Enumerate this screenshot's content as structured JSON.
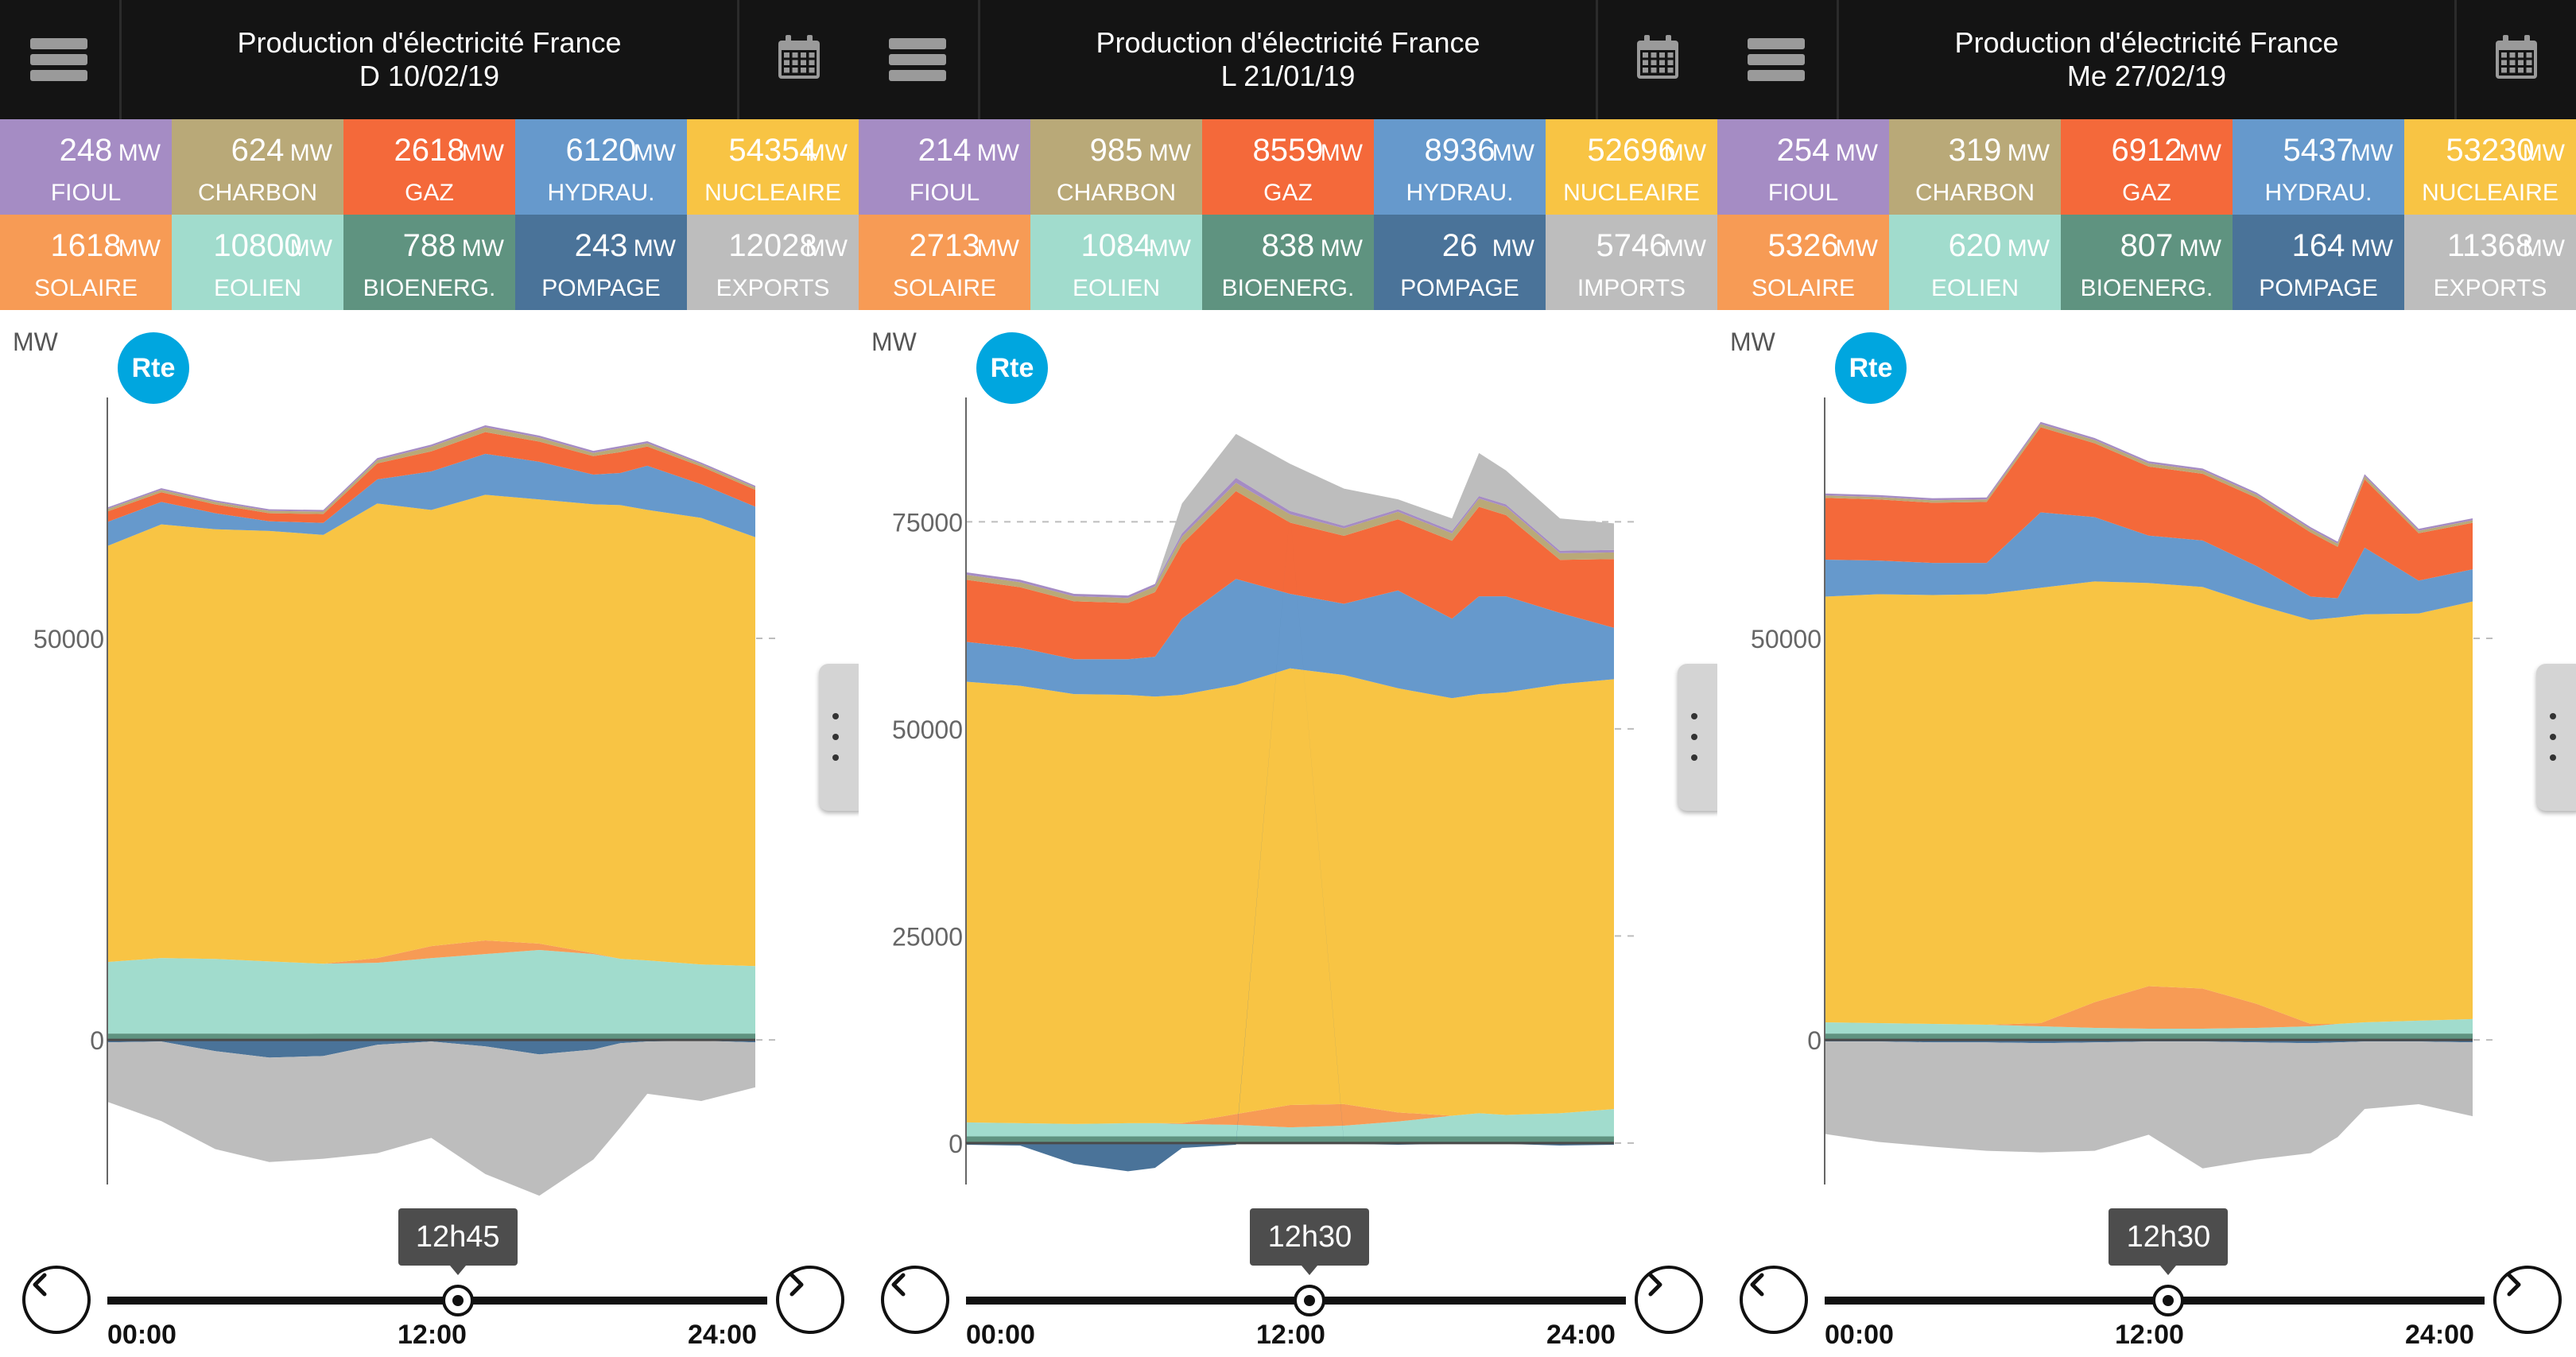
{
  "colors": {
    "fioul": "#a58cc4",
    "charbon": "#b9a978",
    "gaz": "#f4693a",
    "hydrau": "#6699cc",
    "nucleaire": "#f8c444",
    "solaire": "#f79b55",
    "eolien": "#a1dccd",
    "bioenerg": "#5f9380",
    "pompage": "#4a7399",
    "exports": "#bdbdbd",
    "rte_logo": "#00a6df",
    "header_bg": "#141414"
  },
  "icons": {
    "menu": "hamburger-menu-icon",
    "calendar": "calendar-icon",
    "more": "vertical-dots-icon",
    "prev": "chevron-left-icon",
    "next": "chevron-right-icon",
    "logo": "rte-logo"
  },
  "common": {
    "app_title": "Production d'électricité France",
    "unit": "MW",
    "y_axis_unit": "MW",
    "logo_text": "Rte",
    "time_start": "00:00",
    "time_mid": "12:00",
    "time_end": "24:00"
  },
  "panels": [
    {
      "date": "D 10/02/19",
      "tiles": [
        {
          "key": "fioul",
          "value": "248",
          "label": "FIOUL"
        },
        {
          "key": "charbon",
          "value": "624",
          "label": "CHARBON"
        },
        {
          "key": "gaz",
          "value": "2618",
          "label": "GAZ"
        },
        {
          "key": "hydrau",
          "value": "6120",
          "label": "HYDRAU."
        },
        {
          "key": "nucleaire",
          "value": "54354",
          "label": "NUCLEAIRE"
        },
        {
          "key": "solaire",
          "value": "1618",
          "label": "SOLAIRE"
        },
        {
          "key": "eolien",
          "value": "10800",
          "label": "EOLIEN"
        },
        {
          "key": "bioenerg",
          "value": "788",
          "label": "BIOENERG."
        },
        {
          "key": "pompage",
          "value": "243",
          "label": "POMPAGE"
        },
        {
          "key": "exports",
          "value": "12028",
          "label": "EXPORTS"
        }
      ],
      "selected_time": "12h45",
      "selected_fraction": 0.531
    },
    {
      "date": "L 21/01/19",
      "tiles": [
        {
          "key": "fioul",
          "value": "214",
          "label": "FIOUL"
        },
        {
          "key": "charbon",
          "value": "985",
          "label": "CHARBON"
        },
        {
          "key": "gaz",
          "value": "8559",
          "label": "GAZ"
        },
        {
          "key": "hydrau",
          "value": "8936",
          "label": "HYDRAU."
        },
        {
          "key": "nucleaire",
          "value": "52696",
          "label": "NUCLEAIRE"
        },
        {
          "key": "solaire",
          "value": "2713",
          "label": "SOLAIRE"
        },
        {
          "key": "eolien",
          "value": "1084",
          "label": "EOLIEN"
        },
        {
          "key": "bioenerg",
          "value": "838",
          "label": "BIOENERG."
        },
        {
          "key": "pompage",
          "value": "26",
          "label": "POMPAGE"
        },
        {
          "key": "exports",
          "value": "5746",
          "label": "IMPORTS"
        }
      ],
      "selected_time": "12h30",
      "selected_fraction": 0.521
    },
    {
      "date": "Me 27/02/19",
      "tiles": [
        {
          "key": "fioul",
          "value": "254",
          "label": "FIOUL"
        },
        {
          "key": "charbon",
          "value": "319",
          "label": "CHARBON"
        },
        {
          "key": "gaz",
          "value": "6912",
          "label": "GAZ"
        },
        {
          "key": "hydrau",
          "value": "5437",
          "label": "HYDRAU."
        },
        {
          "key": "nucleaire",
          "value": "53230",
          "label": "NUCLEAIRE"
        },
        {
          "key": "solaire",
          "value": "5326",
          "label": "SOLAIRE"
        },
        {
          "key": "eolien",
          "value": "620",
          "label": "EOLIEN"
        },
        {
          "key": "bioenerg",
          "value": "807",
          "label": "BIOENERG."
        },
        {
          "key": "pompage",
          "value": "164",
          "label": "POMPAGE"
        },
        {
          "key": "exports",
          "value": "11368",
          "label": "EXPORTS"
        }
      ],
      "selected_time": "12h30",
      "selected_fraction": 0.521
    }
  ],
  "chart_data": [
    {
      "type": "area",
      "x_label": "",
      "y_label": "MW",
      "x": [
        "00:00",
        "02:00",
        "04:00",
        "06:00",
        "08:00",
        "10:00",
        "12:00",
        "14:00",
        "16:00",
        "18:00",
        "19:00",
        "20:00",
        "22:00",
        "24:00"
      ],
      "xlim": [
        0,
        24
      ],
      "ylim": [
        -18000,
        80000
      ],
      "y_ticks": [
        0,
        50000
      ],
      "grid": true,
      "series": [
        {
          "key": "bioenerg",
          "values": [
            800,
            800,
            790,
            780,
            790,
            800,
            790,
            790,
            800,
            800,
            800,
            800,
            800,
            800
          ]
        },
        {
          "key": "eolien",
          "values": [
            8900,
            9400,
            9300,
            9000,
            8700,
            8800,
            9400,
            9900,
            10400,
            9900,
            9300,
            9100,
            8600,
            8400
          ]
        },
        {
          "key": "solaire",
          "values": [
            0,
            0,
            0,
            0,
            0,
            600,
            1500,
            1700,
            800,
            100,
            0,
            0,
            0,
            0
          ]
        },
        {
          "key": "nucleaire",
          "values": [
            51800,
            54000,
            53500,
            53600,
            53400,
            56600,
            54300,
            55500,
            55300,
            55900,
            56500,
            56100,
            55600,
            53400
          ]
        },
        {
          "key": "hydrau",
          "values": [
            3000,
            2800,
            2000,
            1200,
            1500,
            3000,
            4800,
            5100,
            4700,
            3700,
            4000,
            5500,
            4200,
            3800
          ]
        },
        {
          "key": "gaz",
          "values": [
            1300,
            1200,
            1100,
            1000,
            1100,
            2000,
            2500,
            2700,
            2500,
            2300,
            2600,
            2400,
            2200,
            2100
          ]
        },
        {
          "key": "charbon",
          "values": [
            300,
            300,
            300,
            300,
            300,
            400,
            600,
            600,
            500,
            400,
            500,
            400,
            300,
            300
          ]
        },
        {
          "key": "fioul",
          "values": [
            200,
            200,
            200,
            200,
            200,
            250,
            250,
            250,
            250,
            250,
            250,
            250,
            200,
            200
          ]
        },
        {
          "key": "pompage",
          "values": [
            -300,
            -200,
            -1400,
            -2200,
            -2000,
            -600,
            -200,
            -800,
            -1800,
            -1200,
            -400,
            -200,
            -100,
            -300
          ]
        },
        {
          "key": "exports",
          "values": [
            -7400,
            -9900,
            -12200,
            -13000,
            -12800,
            -13500,
            -12000,
            -15900,
            -17600,
            -13700,
            -10500,
            -6500,
            -7500,
            -5600
          ]
        }
      ]
    },
    {
      "type": "area",
      "x_label": "",
      "y_label": "MW",
      "x": [
        "00:00",
        "02:00",
        "04:00",
        "06:00",
        "07:00",
        "08:00",
        "10:00",
        "12:00",
        "14:00",
        "16:00",
        "18:00",
        "19:00",
        "20:00",
        "22:00",
        "24:00"
      ],
      "xlim": [
        0,
        24
      ],
      "ylim": [
        -5000,
        90000
      ],
      "y_ticks": [
        0,
        25000,
        50000,
        75000
      ],
      "grid": true,
      "series": [
        {
          "key": "bioenerg",
          "values": [
            800,
            800,
            800,
            800,
            800,
            800,
            800,
            800,
            800,
            800,
            800,
            800,
            800,
            800,
            800
          ]
        },
        {
          "key": "eolien",
          "values": [
            1700,
            1600,
            1500,
            1600,
            1600,
            1500,
            1400,
            1100,
            1300,
            1800,
            2500,
            2800,
            2600,
            2800,
            3300
          ]
        },
        {
          "key": "solaire",
          "values": [
            0,
            0,
            0,
            0,
            0,
            100,
            1300,
            2700,
            2600,
            1100,
            0,
            0,
            0,
            0,
            0
          ]
        },
        {
          "key": "nucleaire",
          "values": [
            53200,
            52800,
            51900,
            51700,
            51500,
            51700,
            51800,
            52700,
            51800,
            51200,
            50400,
            50600,
            51000,
            51800,
            51900
          ]
        },
        {
          "key": "hydrau",
          "values": [
            4800,
            4600,
            4200,
            4300,
            4800,
            9200,
            12800,
            9000,
            8600,
            11800,
            9600,
            11800,
            11600,
            8600,
            6200
          ]
        },
        {
          "key": "gaz",
          "values": [
            7500,
            7300,
            7000,
            6800,
            7800,
            9000,
            10600,
            8600,
            8200,
            8600,
            9400,
            10800,
            9800,
            6400,
            8300
          ]
        },
        {
          "key": "charbon",
          "values": [
            600,
            600,
            600,
            600,
            700,
            900,
            1000,
            1000,
            900,
            900,
            900,
            1000,
            1000,
            800,
            800
          ]
        },
        {
          "key": "fioul",
          "values": [
            300,
            300,
            300,
            300,
            300,
            400,
            600,
            400,
            300,
            300,
            300,
            300,
            300,
            300,
            300
          ]
        },
        {
          "key": "pompage",
          "values": [
            -200,
            -300,
            -2500,
            -3400,
            -3000,
            -600,
            -200,
            0,
            -100,
            -200,
            -100,
            -100,
            -100,
            -300,
            -200
          ]
        },
        {
          "key": "exports",
          "values": [
            0,
            0,
            0,
            0,
            0,
            3600,
            5300,
            5700,
            4500,
            1200,
            1500,
            5200,
            4100,
            3900,
            3200
          ]
        }
      ]
    },
    {
      "type": "area",
      "x_label": "",
      "y_label": "MW",
      "x": [
        "00:00",
        "02:00",
        "04:00",
        "06:00",
        "08:00",
        "10:00",
        "12:00",
        "14:00",
        "16:00",
        "18:00",
        "19:00",
        "20:00",
        "22:00",
        "24:00"
      ],
      "xlim": [
        0,
        24
      ],
      "ylim": [
        -18000,
        80000
      ],
      "y_ticks": [
        0,
        50000
      ],
      "grid": true,
      "series": [
        {
          "key": "bioenerg",
          "values": [
            800,
            800,
            800,
            800,
            800,
            800,
            800,
            800,
            800,
            800,
            800,
            800,
            800,
            800
          ]
        },
        {
          "key": "eolien",
          "values": [
            1400,
            1300,
            1200,
            1100,
            900,
            700,
            600,
            600,
            700,
            900,
            1200,
            1400,
            1600,
            1800
          ]
        },
        {
          "key": "solaire",
          "values": [
            0,
            0,
            0,
            0,
            400,
            3200,
            5300,
            5000,
            3000,
            300,
            0,
            0,
            0,
            0
          ]
        },
        {
          "key": "nucleaire",
          "values": [
            53000,
            53400,
            53400,
            53600,
            54200,
            52400,
            50200,
            50000,
            49700,
            50300,
            50600,
            50800,
            50700,
            52000
          ]
        },
        {
          "key": "hydrau",
          "values": [
            4600,
            4200,
            4000,
            3900,
            9400,
            8000,
            5900,
            5800,
            4800,
            2900,
            2400,
            8300,
            4100,
            4000
          ]
        },
        {
          "key": "gaz",
          "values": [
            7700,
            7600,
            7500,
            7600,
            10600,
            9200,
            8600,
            8300,
            8500,
            8000,
            6400,
            8500,
            5900,
            5800
          ]
        },
        {
          "key": "charbon",
          "values": [
            300,
            300,
            300,
            300,
            400,
            400,
            400,
            400,
            400,
            400,
            400,
            400,
            300,
            300
          ]
        },
        {
          "key": "fioul",
          "values": [
            250,
            250,
            250,
            250,
            250,
            250,
            250,
            250,
            250,
            250,
            250,
            250,
            250,
            250
          ]
        },
        {
          "key": "pompage",
          "values": [
            -200,
            -200,
            -300,
            -300,
            -400,
            -300,
            -200,
            -200,
            -300,
            -400,
            -300,
            -200,
            -200,
            -300
          ]
        },
        {
          "key": "exports",
          "values": [
            -11500,
            -12500,
            -13000,
            -13500,
            -13600,
            -13500,
            -11600,
            -15800,
            -14600,
            -13700,
            -11800,
            -8400,
            -7800,
            -9200
          ]
        }
      ]
    }
  ]
}
